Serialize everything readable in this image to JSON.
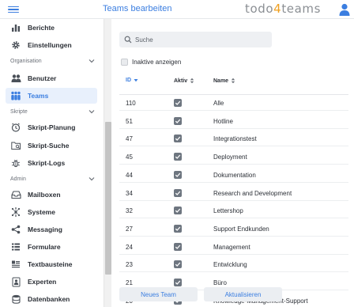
{
  "header": {
    "title": "Teams bearbeiten",
    "logo_part1": "todo",
    "logo_part2": "4",
    "logo_part3": "teams"
  },
  "sidebar": {
    "items_top": [
      {
        "label": "Berichte",
        "icon": "bar-chart-icon"
      },
      {
        "label": "Einstellungen",
        "icon": "gear-icon"
      }
    ],
    "section_org": "Organisation",
    "items_org": [
      {
        "label": "Benutzer",
        "icon": "users-icon"
      },
      {
        "label": "Teams",
        "icon": "teams-icon",
        "active": true
      }
    ],
    "section_scripts": "Skripte",
    "items_scripts": [
      {
        "label": "Skript-Planung",
        "icon": "clock-icon"
      },
      {
        "label": "Skript-Suche",
        "icon": "folder-search-icon"
      },
      {
        "label": "Skript-Logs",
        "icon": "bug-icon"
      }
    ],
    "section_admin": "Admin",
    "items_admin": [
      {
        "label": "Mailboxen",
        "icon": "inbox-icon"
      },
      {
        "label": "Systeme",
        "icon": "network-icon"
      },
      {
        "label": "Messaging",
        "icon": "share-icon"
      },
      {
        "label": "Formulare",
        "icon": "list-form-icon"
      },
      {
        "label": "Textbausteine",
        "icon": "text-block-icon"
      },
      {
        "label": "Experten",
        "icon": "expert-badge-icon"
      },
      {
        "label": "Datenbanken",
        "icon": "database-icon"
      }
    ]
  },
  "search": {
    "placeholder": "Suche"
  },
  "filter": {
    "inactive_label": "Inaktive anzeigen"
  },
  "table": {
    "columns": {
      "id": "ID",
      "active": "Aktiv",
      "name": "Name"
    },
    "rows": [
      {
        "id": "110",
        "name": "Alle"
      },
      {
        "id": "51",
        "name": "Hotline"
      },
      {
        "id": "47",
        "name": "Integrationstest"
      },
      {
        "id": "45",
        "name": "Deployment"
      },
      {
        "id": "44",
        "name": "Dokumentation"
      },
      {
        "id": "34",
        "name": "Research and Development"
      },
      {
        "id": "32",
        "name": "Lettershop"
      },
      {
        "id": "27",
        "name": "Support Endkunden"
      },
      {
        "id": "24",
        "name": "Management"
      },
      {
        "id": "23",
        "name": "Entwicklung"
      },
      {
        "id": "21",
        "name": "Büro"
      },
      {
        "id": "20",
        "name": "Knowledge-Management-Support"
      }
    ]
  },
  "buttons": {
    "new_team": "Neues Team",
    "refresh": "Aktualisieren"
  },
  "colors": {
    "accent": "#3b7ee0",
    "logo_highlight": "#f0a020",
    "active_bg": "#e8f0fc"
  }
}
